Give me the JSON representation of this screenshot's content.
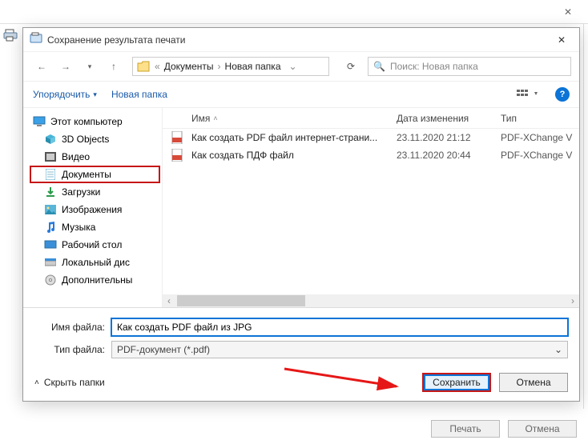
{
  "outer": {
    "close_glyph": "✕"
  },
  "dialog": {
    "title": "Сохранение результата печати",
    "close_glyph": "✕"
  },
  "nav": {
    "back": "←",
    "forward": "→",
    "dropdown": "▾",
    "up": "↑",
    "bc_sep": "«",
    "bc1": "Документы",
    "bc2": "Новая папка",
    "bc_chev": "›",
    "bc_enddrop": "⌄",
    "refresh": "⟳"
  },
  "search": {
    "icon_glyph": "🔍",
    "placeholder": "Поиск: Новая папка"
  },
  "toolbar": {
    "organize": "Упорядочить",
    "drop": "▾",
    "newfolder": "Новая папка",
    "help_glyph": "?"
  },
  "tree": {
    "items": [
      {
        "label": "Этот компьютер"
      },
      {
        "label": "3D Objects"
      },
      {
        "label": "Видео"
      },
      {
        "label": "Документы"
      },
      {
        "label": "Загрузки"
      },
      {
        "label": "Изображения"
      },
      {
        "label": "Музыка"
      },
      {
        "label": "Рабочий стол"
      },
      {
        "label": "Локальный дис"
      },
      {
        "label": "Дополнительны"
      }
    ]
  },
  "columns": {
    "name": "Имя",
    "date": "Дата изменения",
    "type": "Тип",
    "sort_glyph": "˄"
  },
  "files": {
    "rows": [
      {
        "name": "Как создать PDF файл интернет-страни...",
        "date": "23.11.2020 21:12",
        "type": "PDF-XChange V"
      },
      {
        "name": "Как создать ПДФ файл",
        "date": "23.11.2020 20:44",
        "type": "PDF-XChange V"
      }
    ]
  },
  "fields": {
    "name_label": "Имя файла:",
    "name_value": "Как создать PDF файл из JPG",
    "type_label": "Тип файла:",
    "type_value": "PDF-документ (*.pdf)",
    "type_drop": "⌄"
  },
  "actions": {
    "hide_arrow": "˄",
    "hide_label": "Скрыть папки",
    "save": "Сохранить",
    "cancel": "Отмена"
  },
  "bottom": {
    "print": "Печать",
    "cancel": "Отмена"
  },
  "scroll": {
    "left": "‹",
    "right": "›"
  }
}
